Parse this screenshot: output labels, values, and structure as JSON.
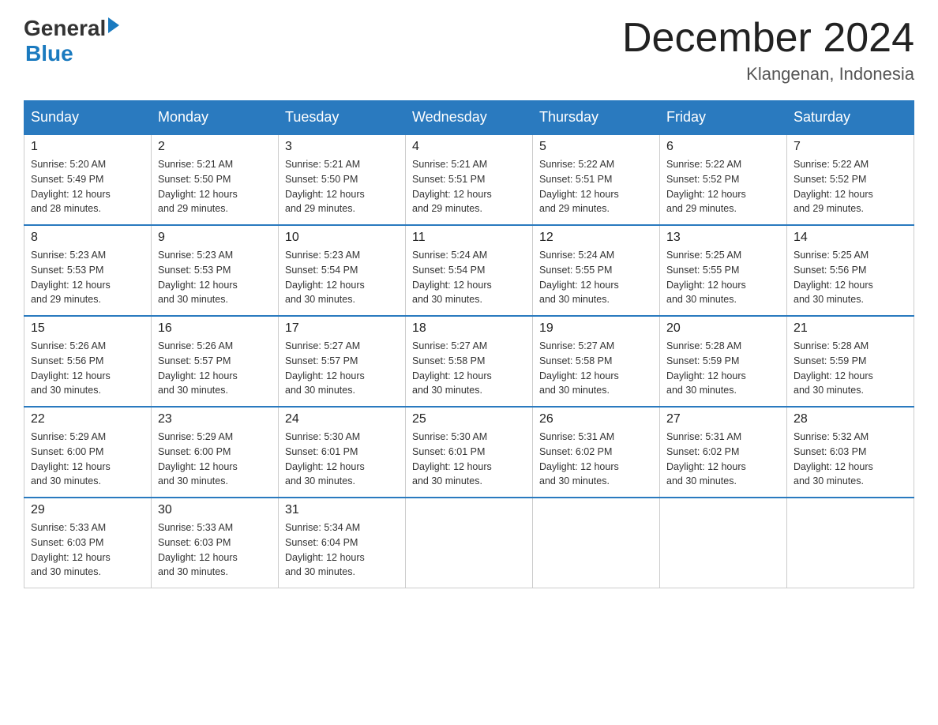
{
  "header": {
    "logo_general": "General",
    "logo_blue": "Blue",
    "month_title": "December 2024",
    "location": "Klangenan, Indonesia"
  },
  "calendar": {
    "days_of_week": [
      "Sunday",
      "Monday",
      "Tuesday",
      "Wednesday",
      "Thursday",
      "Friday",
      "Saturday"
    ],
    "weeks": [
      [
        {
          "day": "1",
          "sunrise": "5:20 AM",
          "sunset": "5:49 PM",
          "daylight": "12 hours and 28 minutes."
        },
        {
          "day": "2",
          "sunrise": "5:21 AM",
          "sunset": "5:50 PM",
          "daylight": "12 hours and 29 minutes."
        },
        {
          "day": "3",
          "sunrise": "5:21 AM",
          "sunset": "5:50 PM",
          "daylight": "12 hours and 29 minutes."
        },
        {
          "day": "4",
          "sunrise": "5:21 AM",
          "sunset": "5:51 PM",
          "daylight": "12 hours and 29 minutes."
        },
        {
          "day": "5",
          "sunrise": "5:22 AM",
          "sunset": "5:51 PM",
          "daylight": "12 hours and 29 minutes."
        },
        {
          "day": "6",
          "sunrise": "5:22 AM",
          "sunset": "5:52 PM",
          "daylight": "12 hours and 29 minutes."
        },
        {
          "day": "7",
          "sunrise": "5:22 AM",
          "sunset": "5:52 PM",
          "daylight": "12 hours and 29 minutes."
        }
      ],
      [
        {
          "day": "8",
          "sunrise": "5:23 AM",
          "sunset": "5:53 PM",
          "daylight": "12 hours and 29 minutes."
        },
        {
          "day": "9",
          "sunrise": "5:23 AM",
          "sunset": "5:53 PM",
          "daylight": "12 hours and 30 minutes."
        },
        {
          "day": "10",
          "sunrise": "5:23 AM",
          "sunset": "5:54 PM",
          "daylight": "12 hours and 30 minutes."
        },
        {
          "day": "11",
          "sunrise": "5:24 AM",
          "sunset": "5:54 PM",
          "daylight": "12 hours and 30 minutes."
        },
        {
          "day": "12",
          "sunrise": "5:24 AM",
          "sunset": "5:55 PM",
          "daylight": "12 hours and 30 minutes."
        },
        {
          "day": "13",
          "sunrise": "5:25 AM",
          "sunset": "5:55 PM",
          "daylight": "12 hours and 30 minutes."
        },
        {
          "day": "14",
          "sunrise": "5:25 AM",
          "sunset": "5:56 PM",
          "daylight": "12 hours and 30 minutes."
        }
      ],
      [
        {
          "day": "15",
          "sunrise": "5:26 AM",
          "sunset": "5:56 PM",
          "daylight": "12 hours and 30 minutes."
        },
        {
          "day": "16",
          "sunrise": "5:26 AM",
          "sunset": "5:57 PM",
          "daylight": "12 hours and 30 minutes."
        },
        {
          "day": "17",
          "sunrise": "5:27 AM",
          "sunset": "5:57 PM",
          "daylight": "12 hours and 30 minutes."
        },
        {
          "day": "18",
          "sunrise": "5:27 AM",
          "sunset": "5:58 PM",
          "daylight": "12 hours and 30 minutes."
        },
        {
          "day": "19",
          "sunrise": "5:27 AM",
          "sunset": "5:58 PM",
          "daylight": "12 hours and 30 minutes."
        },
        {
          "day": "20",
          "sunrise": "5:28 AM",
          "sunset": "5:59 PM",
          "daylight": "12 hours and 30 minutes."
        },
        {
          "day": "21",
          "sunrise": "5:28 AM",
          "sunset": "5:59 PM",
          "daylight": "12 hours and 30 minutes."
        }
      ],
      [
        {
          "day": "22",
          "sunrise": "5:29 AM",
          "sunset": "6:00 PM",
          "daylight": "12 hours and 30 minutes."
        },
        {
          "day": "23",
          "sunrise": "5:29 AM",
          "sunset": "6:00 PM",
          "daylight": "12 hours and 30 minutes."
        },
        {
          "day": "24",
          "sunrise": "5:30 AM",
          "sunset": "6:01 PM",
          "daylight": "12 hours and 30 minutes."
        },
        {
          "day": "25",
          "sunrise": "5:30 AM",
          "sunset": "6:01 PM",
          "daylight": "12 hours and 30 minutes."
        },
        {
          "day": "26",
          "sunrise": "5:31 AM",
          "sunset": "6:02 PM",
          "daylight": "12 hours and 30 minutes."
        },
        {
          "day": "27",
          "sunrise": "5:31 AM",
          "sunset": "6:02 PM",
          "daylight": "12 hours and 30 minutes."
        },
        {
          "day": "28",
          "sunrise": "5:32 AM",
          "sunset": "6:03 PM",
          "daylight": "12 hours and 30 minutes."
        }
      ],
      [
        {
          "day": "29",
          "sunrise": "5:33 AM",
          "sunset": "6:03 PM",
          "daylight": "12 hours and 30 minutes."
        },
        {
          "day": "30",
          "sunrise": "5:33 AM",
          "sunset": "6:03 PM",
          "daylight": "12 hours and 30 minutes."
        },
        {
          "day": "31",
          "sunrise": "5:34 AM",
          "sunset": "6:04 PM",
          "daylight": "12 hours and 30 minutes."
        },
        null,
        null,
        null,
        null
      ]
    ],
    "labels": {
      "sunrise": "Sunrise:",
      "sunset": "Sunset:",
      "daylight": "Daylight:"
    }
  }
}
